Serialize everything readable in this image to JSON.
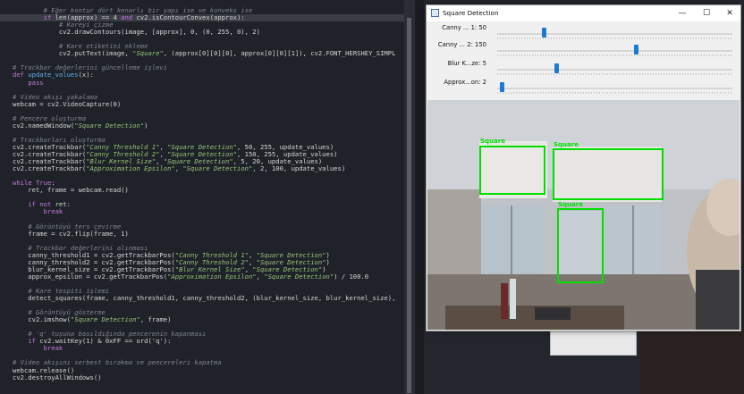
{
  "editor": {
    "lines": [
      "        # Eğer kontur dört kenarlı bir yapı ise ve konveks ise",
      "        if len(approx) == 4 and cv2.isContourConvex(approx):",
      "            # Kareyi çizme",
      "            cv2.drawContours(image, [approx], 0, (0, 255, 0), 2)",
      "",
      "            # Kare etiketini ekleme",
      "            cv2.putText(image, \"Square\", (approx[0][0][0], approx[0][0][1]), cv2.FONT_HERSHEY_SIMPL",
      "",
      "# Trackbar değerlerini güncelleme işlevi",
      "def update_values(x):",
      "    pass",
      "",
      "# Video akışı yakalama",
      "webcam = cv2.VideoCapture(0)",
      "",
      "# Pencere oluşturma",
      "cv2.namedWindow(\"Square Detection\")",
      "",
      "# Trackbarları oluşturma",
      "cv2.createTrackbar(\"Canny Threshold 1\", \"Square Detection\", 50, 255, update_values)",
      "cv2.createTrackbar(\"Canny Threshold 2\", \"Square Detection\", 150, 255, update_values)",
      "cv2.createTrackbar(\"Blur Kernel Size\", \"Square Detection\", 5, 20, update_values)",
      "cv2.createTrackbar(\"Approximation Epsilon\", \"Square Detection\", 2, 100, update_values)",
      "",
      "while True:",
      "    ret, frame = webcam.read()",
      "",
      "    if not ret:",
      "        break",
      "",
      "    # Görüntüyü ters çevirme",
      "    frame = cv2.flip(frame, 1)",
      "",
      "    # Trackbar değerlerini alınması",
      "    canny_threshold1 = cv2.getTrackbarPos(\"Canny Threshold 1\", \"Square Detection\")",
      "    canny_threshold2 = cv2.getTrackbarPos(\"Canny Threshold 2\", \"Square Detection\")",
      "    blur_kernel_size = cv2.getTrackbarPos(\"Blur Kernel Size\", \"Square Detection\")",
      "    approx_epsilon = cv2.getTrackbarPos(\"Approximation Epsilon\", \"Square Detection\") / 100.0",
      "",
      "    # Kare tespiti işlemi",
      "    detect_squares(frame, canny_threshold1, canny_threshold2, (blur_kernel_size, blur_kernel_size),",
      "",
      "    # Görüntüyü gösterme",
      "    cv2.imshow(\"Square Detection\", frame)",
      "",
      "    # 'q' tuşuna basıldığında pencerenin kapanması",
      "    if cv2.waitKey(1) & 0xFF == ord('q'):",
      "        break",
      "",
      "# Video akışını serbest bırakma ve pencereleri kapatma",
      "webcam.release()",
      "cv2.destroyAllWindows()"
    ]
  },
  "window": {
    "title": "Square Detection",
    "minimize": "—",
    "maximize": "☐",
    "close": "✕",
    "trackbars": [
      {
        "label": "Canny ... 1: 50",
        "value": 50,
        "max": 255
      },
      {
        "label": "Canny ... 2: 150",
        "value": 150,
        "max": 255
      },
      {
        "label": "Blur K...ze: 5",
        "value": 5,
        "max": 20
      },
      {
        "label": "Approx...on: 2",
        "value": 2,
        "max": 100
      }
    ],
    "detections": [
      "Square",
      "Square",
      "Square"
    ]
  },
  "colors": {
    "accent": "#1f78d1",
    "detection": "#00e000",
    "editor_bg": "#1f2229"
  }
}
